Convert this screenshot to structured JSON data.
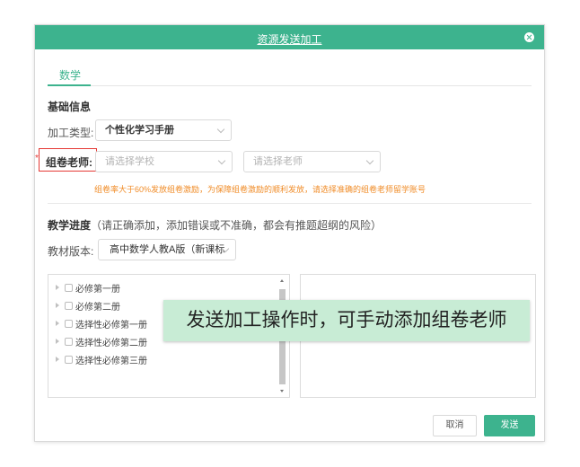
{
  "dialog": {
    "title": "资源发送加工",
    "close_icon": "close-icon"
  },
  "tabs": [
    {
      "label": "数学",
      "active": true
    }
  ],
  "basic_info": {
    "section_title": "基础信息",
    "process_type_label": "加工类型:",
    "process_type_value": "个性化学习手册",
    "teacher_label": "组卷老师:",
    "school_placeholder": "请选择学校",
    "teacher_placeholder": "请选择老师",
    "warning": "组卷率大于60%发放组卷激励，为保障组卷激励的顺利发放，请选择准确的组卷老师留学账号"
  },
  "progress": {
    "section_title": "教学进度",
    "hint": "（请正确添加，添加错误或不准确，都会有推题超纲的风险）",
    "textbook_label": "教材版本:",
    "textbook_value": "高中数学人教A版（新课标"
  },
  "tree": {
    "items": [
      {
        "label": "必修第一册"
      },
      {
        "label": "必修第二册"
      },
      {
        "label": "选择性必修第一册"
      },
      {
        "label": "选择性必修第二册"
      },
      {
        "label": "选择性必修第三册"
      }
    ]
  },
  "footer": {
    "cancel_label": "取消",
    "send_label": "发送"
  },
  "callout": {
    "text": "发送加工操作时，可手动添加组卷老师"
  },
  "colors": {
    "accent": "#3db38e",
    "warning": "#f08c28",
    "highlight": "#e53935",
    "callout_bg": "#c8ecd5"
  }
}
